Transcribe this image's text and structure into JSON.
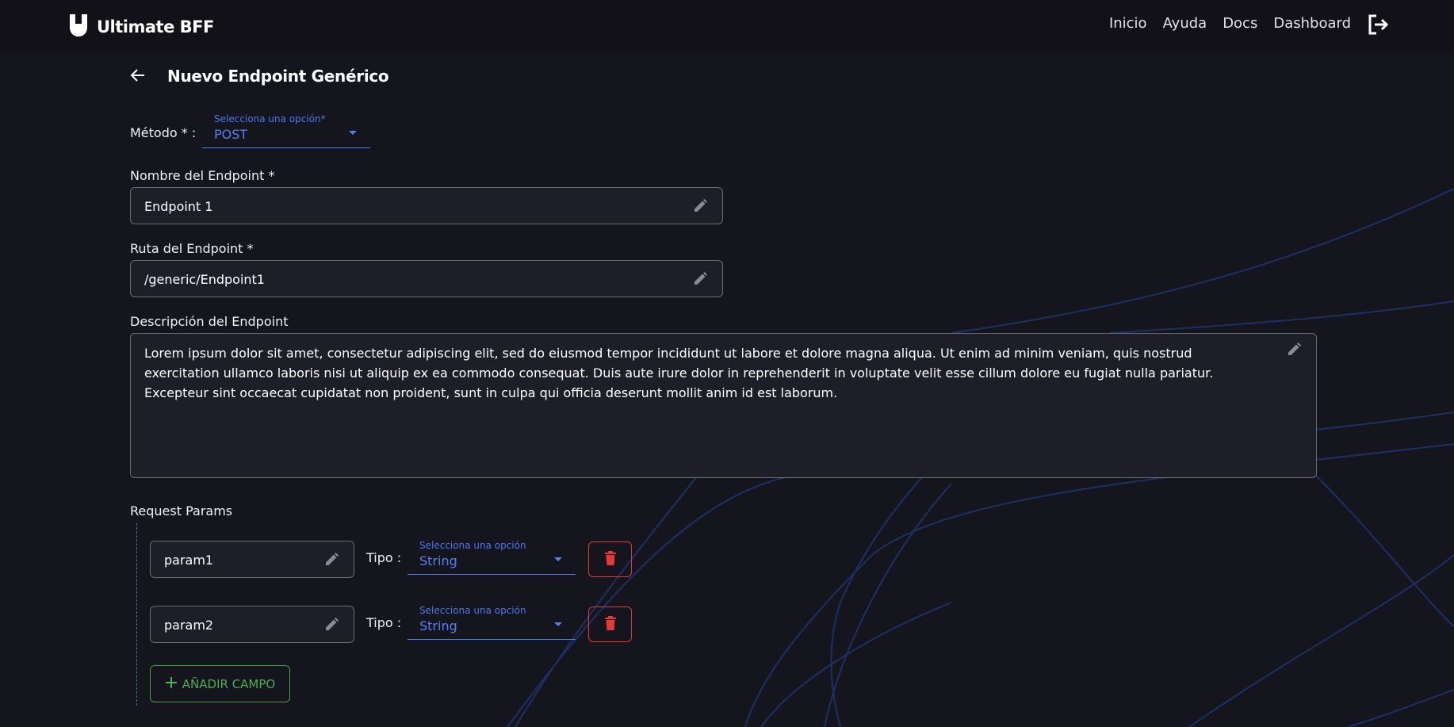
{
  "header": {
    "app_title": "Ultimate BFF",
    "nav": [
      "Inicio",
      "Ayuda",
      "Docs",
      "Dashboard"
    ]
  },
  "page": {
    "title": "Nuevo Endpoint Genérico"
  },
  "form": {
    "method": {
      "label": "Método * :",
      "caption": "Selecciona una opción*",
      "value": "POST"
    },
    "name": {
      "label": "Nombre del Endpoint *",
      "value": "Endpoint 1"
    },
    "route": {
      "label": "Ruta del Endpoint *",
      "value": "/generic/Endpoint1"
    },
    "description": {
      "label": "Descripción del Endpoint",
      "value": "Lorem ipsum dolor sit amet, consectetur adipiscing elit, sed do eiusmod tempor incididunt ut labore et dolore magna aliqua. Ut enim ad minim veniam, quis nostrud exercitation ullamco laboris nisi ut aliquip ex ea commodo consequat. Duis aute irure dolor in reprehenderit in voluptate velit esse cillum dolore eu fugiat nulla pariatur. Excepteur sint occaecat cupidatat non proident, sunt in culpa qui officia deserunt mollit anim id est laborum."
    }
  },
  "request_params": {
    "label": "Request Params",
    "type_label": "Tipo :",
    "type_caption": "Selecciona una opción",
    "items": [
      {
        "name": "param1",
        "type": "String"
      },
      {
        "name": "param2",
        "type": "String"
      }
    ],
    "add_button_label": "AÑADIR CAMPO"
  },
  "colors": {
    "background": "#15151d",
    "accent_blue": "#5680f2",
    "delete_red": "#e53935",
    "add_green": "#4caf50"
  },
  "icons": [
    "logo-u-icon",
    "logout-icon",
    "back-arrow-icon",
    "pencil-icon",
    "chevron-down-icon",
    "trash-icon",
    "plus-icon"
  ]
}
